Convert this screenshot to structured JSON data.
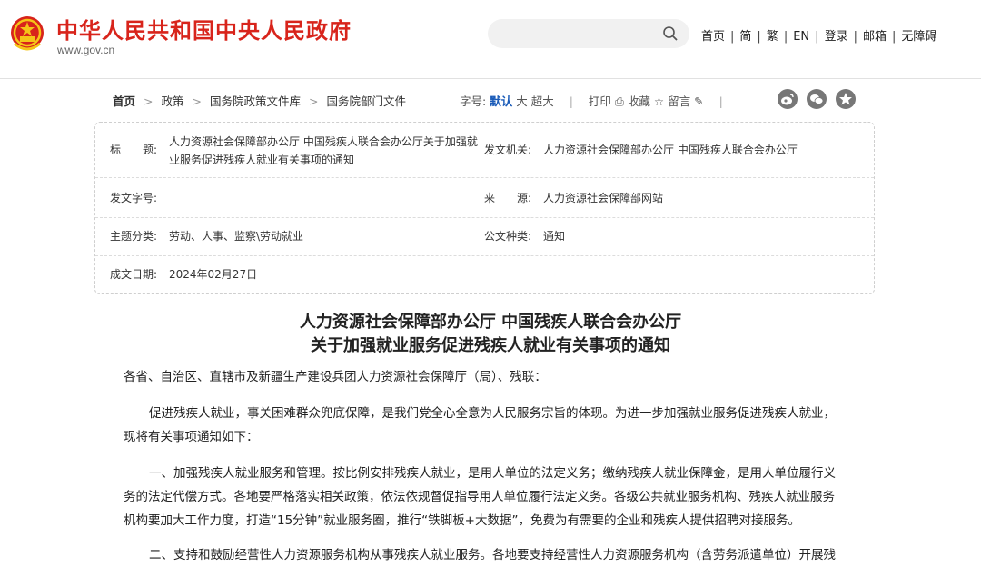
{
  "header": {
    "site_title": "中华人民共和国中央人民政府",
    "site_url": "www.gov.cn",
    "search_placeholder": "",
    "nav": [
      "首页",
      "简",
      "繁",
      "EN",
      "登录",
      "邮箱",
      "无障碍"
    ]
  },
  "breadcrumb": [
    "首页",
    "政策",
    "国务院政策文件库",
    "国务院部门文件"
  ],
  "tools": {
    "font_label": "字号:",
    "font_default": "默认",
    "font_large": "大",
    "font_xlarge": "超大",
    "print": "打印",
    "favorite": "收藏",
    "comment": "留言"
  },
  "meta": {
    "title_label": "标　　题:",
    "title_value_1": "人力资源社会保障部办公厅 中国残疾人联合会办公厅关于加强就",
    "title_value_2": "业服务促进残疾人就业有关事项的通知",
    "issuer_label": "发文机关:",
    "issuer_value": "人力资源社会保障部办公厅  中国残疾人联合会办公厅",
    "doc_no_label": "发文字号:",
    "doc_no_value": "",
    "source_label": "来　　源:",
    "source_value": "人力资源社会保障部网站",
    "topic_label": "主题分类:",
    "topic_value": "劳动、人事、监察\\劳动就业",
    "type_label": "公文种类:",
    "type_value": "通知",
    "date_label": "成文日期:",
    "date_value": "2024年02月27日"
  },
  "article": {
    "title_line1": "人力资源社会保障部办公厅  中国残疾人联合会办公厅",
    "title_line2": "关于加强就业服务促进残疾人就业有关事项的通知",
    "salutation": "各省、自治区、直辖市及新疆生产建设兵团人力资源社会保障厅（局）、残联：",
    "p1_l1": "促进残疾人就业，事关困难群众兜底保障，是我们党全心全意为人民服务宗旨的体现。为进一步加强就业服务促进残疾人就业，",
    "p1_l2": "现将有关事项通知如下：",
    "p2_l1": "一、加强残疾人就业服务和管理。按比例安排残疾人就业，是用人单位的法定义务；缴纳残疾人就业保障金，是用人单位履行义",
    "p2_l2": "务的法定代偿方式。各地要严格落实相关政策，依法依规督促指导用人单位履行法定义务。各级公共就业服务机构、残疾人就业服务",
    "p2_l3": "机构要加大工作力度，打造“15分钟”就业服务圈，推行“铁脚板+大数据”，免费为有需要的企业和残疾人提供招聘对接服务。",
    "p3_l1": "二、支持和鼓励经营性人力资源服务机构从事残疾人就业服务。各地要支持经营性人力资源服务机构（含劳务派遣单位）开展残"
  },
  "colors": {
    "brand_red": "#d8241b",
    "link_blue": "#1a5bb8"
  }
}
